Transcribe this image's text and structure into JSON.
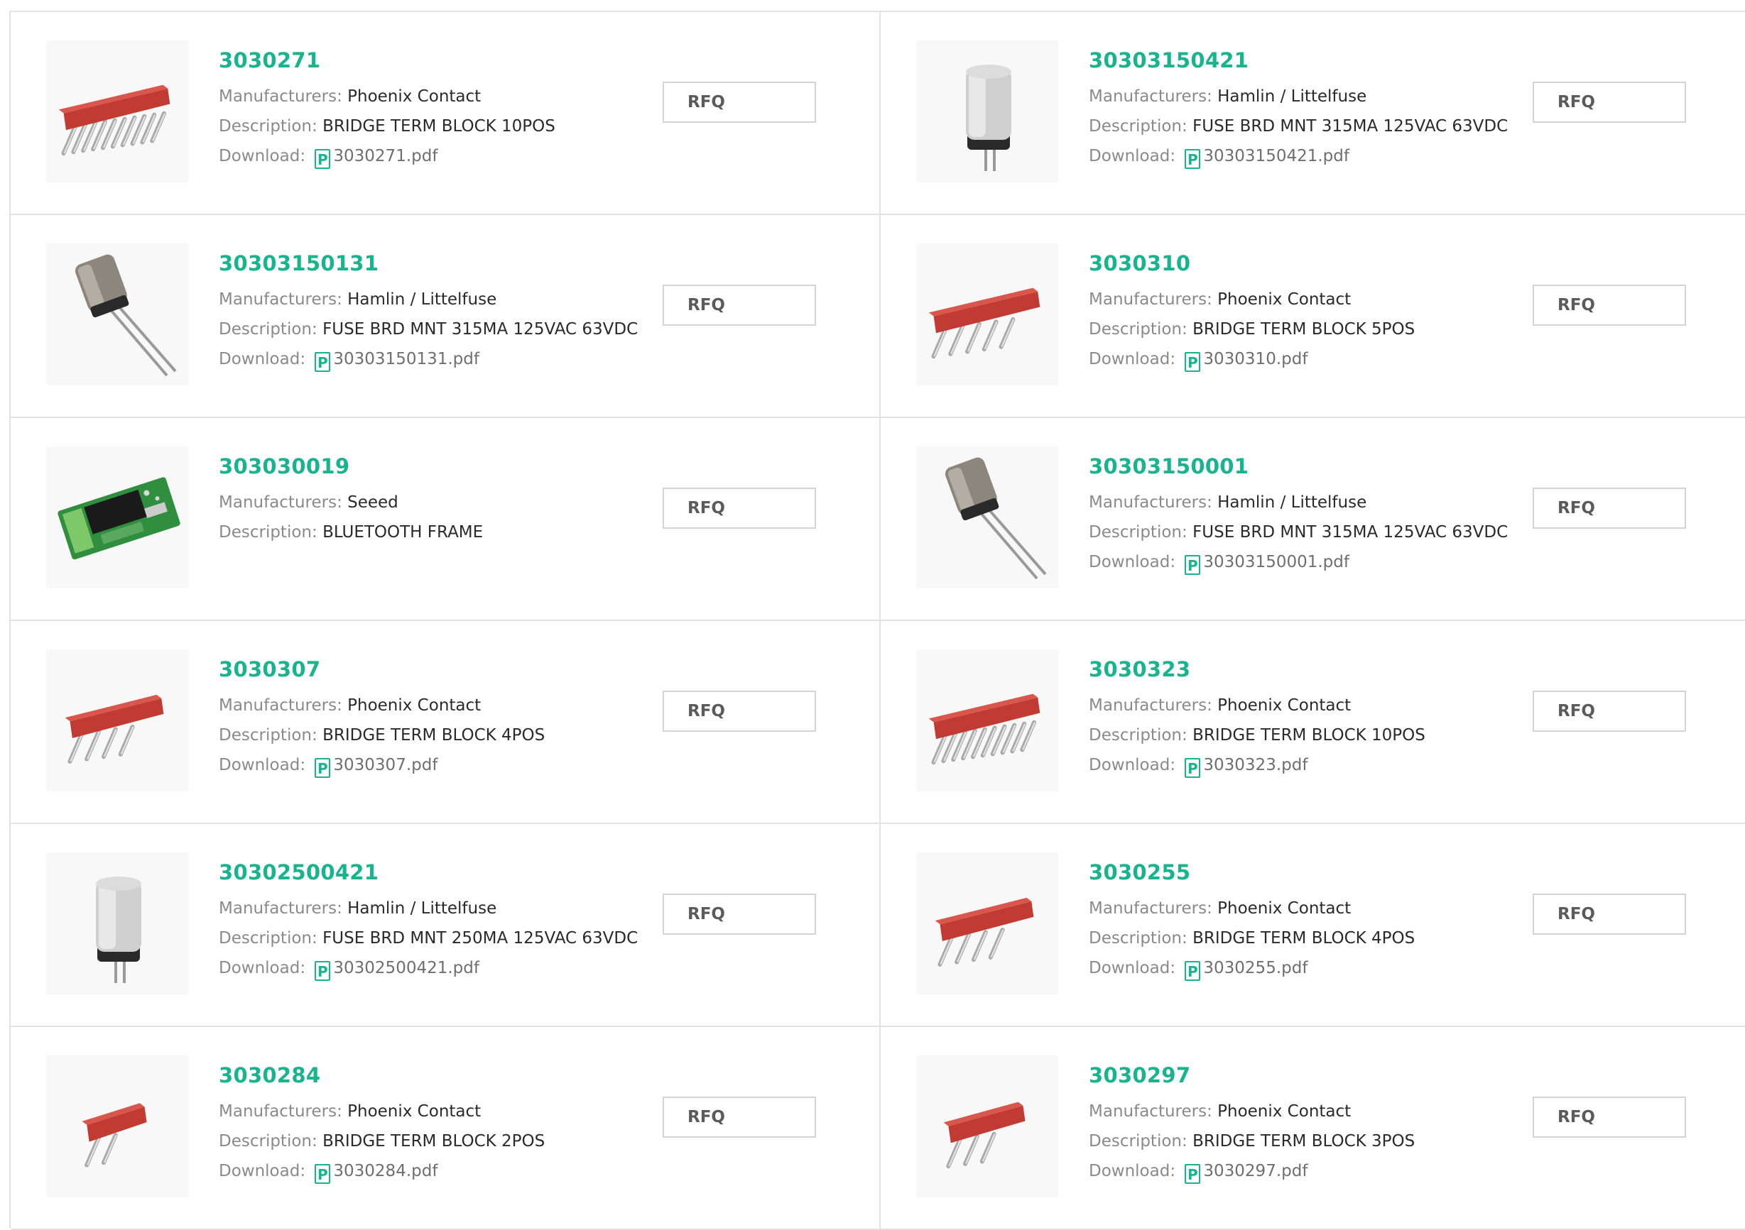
{
  "labels": {
    "manufacturers": "Manufacturers:",
    "description": "Description:",
    "download": "Download:",
    "rfq": "RFQ",
    "pdf_glyph": "P"
  },
  "products": [
    {
      "part": "3030271",
      "manufacturer": "Phoenix Contact",
      "description": "BRIDGE TERM BLOCK 10POS",
      "download": "3030271.pdf",
      "image": "bridge-10pos"
    },
    {
      "part": "30303150421",
      "manufacturer": "Hamlin / Littelfuse",
      "description": "FUSE BRD MNT 315MA 125VAC 63VDC",
      "download": "30303150421.pdf",
      "image": "fuse-short"
    },
    {
      "part": "30303150131",
      "manufacturer": "Hamlin / Littelfuse",
      "description": "FUSE BRD MNT 315MA 125VAC 63VDC",
      "download": "30303150131.pdf",
      "image": "fuse-long"
    },
    {
      "part": "3030310",
      "manufacturer": "Phoenix Contact",
      "description": "BRIDGE TERM BLOCK 5POS",
      "download": "3030310.pdf",
      "image": "bridge-5pos"
    },
    {
      "part": "303030019",
      "manufacturer": "Seeed",
      "description": "BLUETOOTH FRAME",
      "download": null,
      "image": "bluetooth"
    },
    {
      "part": "30303150001",
      "manufacturer": "Hamlin / Littelfuse",
      "description": "FUSE BRD MNT 315MA 125VAC 63VDC",
      "download": "30303150001.pdf",
      "image": "fuse-long"
    },
    {
      "part": "3030307",
      "manufacturer": "Phoenix Contact",
      "description": "BRIDGE TERM BLOCK 4POS",
      "download": "3030307.pdf",
      "image": "bridge-4pos"
    },
    {
      "part": "3030323",
      "manufacturer": "Phoenix Contact",
      "description": "BRIDGE TERM BLOCK 10POS",
      "download": "3030323.pdf",
      "image": "bridge-10pos"
    },
    {
      "part": "30302500421",
      "manufacturer": "Hamlin / Littelfuse",
      "description": "FUSE BRD MNT 250MA 125VAC 63VDC",
      "download": "30302500421.pdf",
      "image": "fuse-short"
    },
    {
      "part": "3030255",
      "manufacturer": "Phoenix Contact",
      "description": "BRIDGE TERM BLOCK 4POS",
      "download": "3030255.pdf",
      "image": "bridge-4pos"
    },
    {
      "part": "3030284",
      "manufacturer": "Phoenix Contact",
      "description": "BRIDGE TERM BLOCK 2POS",
      "download": "3030284.pdf",
      "image": "bridge-2pos"
    },
    {
      "part": "3030297",
      "manufacturer": "Phoenix Contact",
      "description": "BRIDGE TERM BLOCK 3POS",
      "download": "3030297.pdf",
      "image": "bridge-3pos"
    }
  ],
  "colors": {
    "accent": "#17b48e",
    "border": "#e2e2e2",
    "bridge_red": "#c23b32",
    "label_gray": "#8a8a8a"
  }
}
